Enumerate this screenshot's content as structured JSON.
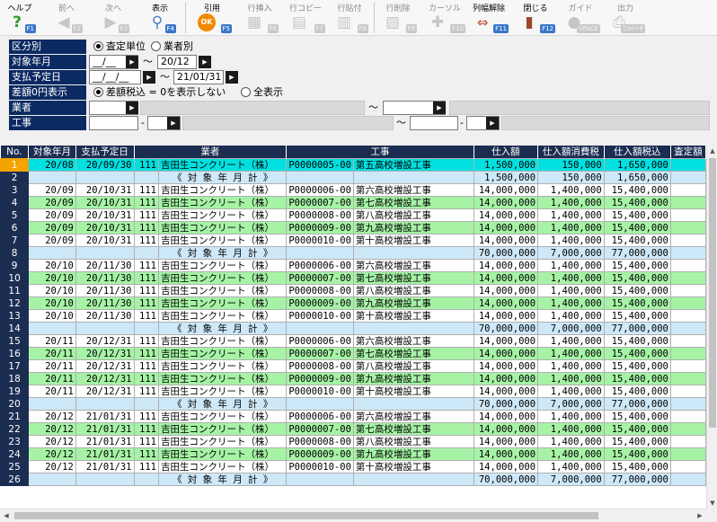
{
  "toolbar": {
    "help": {
      "label": "ヘルプ",
      "key": "F1"
    },
    "prev": {
      "label": "前へ",
      "key": "F2"
    },
    "next": {
      "label": "次へ",
      "key": "F3"
    },
    "show": {
      "label": "表示",
      "key": "F4"
    },
    "cite": {
      "label": "引用",
      "key": "F5",
      "icon_text": "OK"
    },
    "row_insert": {
      "label": "行挿入",
      "key": "F6"
    },
    "row_copy": {
      "label": "行コピー",
      "key": "F7"
    },
    "row_paste": {
      "label": "行貼付",
      "key": "F8"
    },
    "row_delete": {
      "label": "行削除",
      "key": "F9"
    },
    "cursor": {
      "label": "カーソル",
      "key": "F10"
    },
    "column_reset": {
      "label": "列幅解除",
      "key": "F11"
    },
    "close": {
      "label": "閉じる",
      "key": "F12"
    },
    "guide": {
      "label": "ガイド",
      "key": "SPACE"
    },
    "output": {
      "label": "出力",
      "key": "Ctrl+P"
    }
  },
  "filters": {
    "kubun": {
      "label": "区分別",
      "option1": "査定単位",
      "option2": "業者別",
      "selected": "査定単位"
    },
    "taisho": {
      "label": "対象年月",
      "from": "__/__",
      "tilde": "～",
      "to": "20/12"
    },
    "shiharai": {
      "label": "支払予定日",
      "from": "__/__/__",
      "tilde": "～",
      "to": "21/01/31"
    },
    "sagaku": {
      "label": "差額0円表示",
      "option1": "差額税込 = 0を表示しない",
      "option2": "全表示",
      "selected": "差額税込 = 0を表示しない"
    },
    "gyosha": {
      "label": "業者",
      "tilde": "～"
    },
    "koji": {
      "label": "工事",
      "dash": "-",
      "tilde": "～"
    }
  },
  "grid": {
    "columns": [
      "No.",
      "対象年月",
      "支払予定日",
      "業者",
      "工事",
      "仕入額",
      "仕入額消費税",
      "仕入額税込",
      "査定額"
    ],
    "rows": [
      {
        "no": "1",
        "ym": "20/08",
        "pay": "20/09/30",
        "vc": "111",
        "vn": "吉田生コンクリート（株）",
        "pc": "P0000005-00",
        "pn": "第五高校増設工事",
        "amt": "1,500,000",
        "tax": "150,000",
        "total": "1,650,000",
        "t": "sel"
      },
      {
        "no": "2",
        "sub": "《 対 象 年 月 計 》",
        "amt": "1,500,000",
        "tax": "150,000",
        "total": "1,650,000",
        "t": "s"
      },
      {
        "no": "3",
        "ym": "20/09",
        "pay": "20/10/31",
        "vc": "111",
        "vn": "吉田生コンクリート（株）",
        "pc": "P0000006-00",
        "pn": "第六高校増設工事",
        "amt": "14,000,000",
        "tax": "1,400,000",
        "total": "15,400,000",
        "t": "w"
      },
      {
        "no": "4",
        "ym": "20/09",
        "pay": "20/10/31",
        "vc": "111",
        "vn": "吉田生コンクリート（株）",
        "pc": "P0000007-00",
        "pn": "第七高校増設工事",
        "amt": "14,000,000",
        "tax": "1,400,000",
        "total": "15,400,000",
        "t": "g"
      },
      {
        "no": "5",
        "ym": "20/09",
        "pay": "20/10/31",
        "vc": "111",
        "vn": "吉田生コンクリート（株）",
        "pc": "P0000008-00",
        "pn": "第八高校増設工事",
        "amt": "14,000,000",
        "tax": "1,400,000",
        "total": "15,400,000",
        "t": "w"
      },
      {
        "no": "6",
        "ym": "20/09",
        "pay": "20/10/31",
        "vc": "111",
        "vn": "吉田生コンクリート（株）",
        "pc": "P0000009-00",
        "pn": "第九高校増設工事",
        "amt": "14,000,000",
        "tax": "1,400,000",
        "total": "15,400,000",
        "t": "g"
      },
      {
        "no": "7",
        "ym": "20/09",
        "pay": "20/10/31",
        "vc": "111",
        "vn": "吉田生コンクリート（株）",
        "pc": "P0000010-00",
        "pn": "第十高校増設工事",
        "amt": "14,000,000",
        "tax": "1,400,000",
        "total": "15,400,000",
        "t": "w"
      },
      {
        "no": "8",
        "sub": "《 対 象 年 月 計 》",
        "amt": "70,000,000",
        "tax": "7,000,000",
        "total": "77,000,000",
        "t": "s"
      },
      {
        "no": "9",
        "ym": "20/10",
        "pay": "20/11/30",
        "vc": "111",
        "vn": "吉田生コンクリート（株）",
        "pc": "P0000006-00",
        "pn": "第六高校増設工事",
        "amt": "14,000,000",
        "tax": "1,400,000",
        "total": "15,400,000",
        "t": "w"
      },
      {
        "no": "10",
        "ym": "20/10",
        "pay": "20/11/30",
        "vc": "111",
        "vn": "吉田生コンクリート（株）",
        "pc": "P0000007-00",
        "pn": "第七高校増設工事",
        "amt": "14,000,000",
        "tax": "1,400,000",
        "total": "15,400,000",
        "t": "g"
      },
      {
        "no": "11",
        "ym": "20/10",
        "pay": "20/11/30",
        "vc": "111",
        "vn": "吉田生コンクリート（株）",
        "pc": "P0000008-00",
        "pn": "第八高校増設工事",
        "amt": "14,000,000",
        "tax": "1,400,000",
        "total": "15,400,000",
        "t": "w"
      },
      {
        "no": "12",
        "ym": "20/10",
        "pay": "20/11/30",
        "vc": "111",
        "vn": "吉田生コンクリート（株）",
        "pc": "P0000009-00",
        "pn": "第九高校増設工事",
        "amt": "14,000,000",
        "tax": "1,400,000",
        "total": "15,400,000",
        "t": "g"
      },
      {
        "no": "13",
        "ym": "20/10",
        "pay": "20/11/30",
        "vc": "111",
        "vn": "吉田生コンクリート（株）",
        "pc": "P0000010-00",
        "pn": "第十高校増設工事",
        "amt": "14,000,000",
        "tax": "1,400,000",
        "total": "15,400,000",
        "t": "w"
      },
      {
        "no": "14",
        "sub": "《 対 象 年 月 計 》",
        "amt": "70,000,000",
        "tax": "7,000,000",
        "total": "77,000,000",
        "t": "s"
      },
      {
        "no": "15",
        "ym": "20/11",
        "pay": "20/12/31",
        "vc": "111",
        "vn": "吉田生コンクリート（株）",
        "pc": "P0000006-00",
        "pn": "第六高校増設工事",
        "amt": "14,000,000",
        "tax": "1,400,000",
        "total": "15,400,000",
        "t": "w"
      },
      {
        "no": "16",
        "ym": "20/11",
        "pay": "20/12/31",
        "vc": "111",
        "vn": "吉田生コンクリート（株）",
        "pc": "P0000007-00",
        "pn": "第七高校増設工事",
        "amt": "14,000,000",
        "tax": "1,400,000",
        "total": "15,400,000",
        "t": "g"
      },
      {
        "no": "17",
        "ym": "20/11",
        "pay": "20/12/31",
        "vc": "111",
        "vn": "吉田生コンクリート（株）",
        "pc": "P0000008-00",
        "pn": "第八高校増設工事",
        "amt": "14,000,000",
        "tax": "1,400,000",
        "total": "15,400,000",
        "t": "w"
      },
      {
        "no": "18",
        "ym": "20/11",
        "pay": "20/12/31",
        "vc": "111",
        "vn": "吉田生コンクリート（株）",
        "pc": "P0000009-00",
        "pn": "第九高校増設工事",
        "amt": "14,000,000",
        "tax": "1,400,000",
        "total": "15,400,000",
        "t": "g"
      },
      {
        "no": "19",
        "ym": "20/11",
        "pay": "20/12/31",
        "vc": "111",
        "vn": "吉田生コンクリート（株）",
        "pc": "P0000010-00",
        "pn": "第十高校増設工事",
        "amt": "14,000,000",
        "tax": "1,400,000",
        "total": "15,400,000",
        "t": "w"
      },
      {
        "no": "20",
        "sub": "《 対 象 年 月 計 》",
        "amt": "70,000,000",
        "tax": "7,000,000",
        "total": "77,000,000",
        "t": "s"
      },
      {
        "no": "21",
        "ym": "20/12",
        "pay": "21/01/31",
        "vc": "111",
        "vn": "吉田生コンクリート（株）",
        "pc": "P0000006-00",
        "pn": "第六高校増設工事",
        "amt": "14,000,000",
        "tax": "1,400,000",
        "total": "15,400,000",
        "t": "w"
      },
      {
        "no": "22",
        "ym": "20/12",
        "pay": "21/01/31",
        "vc": "111",
        "vn": "吉田生コンクリート（株）",
        "pc": "P0000007-00",
        "pn": "第七高校増設工事",
        "amt": "14,000,000",
        "tax": "1,400,000",
        "total": "15,400,000",
        "t": "g"
      },
      {
        "no": "23",
        "ym": "20/12",
        "pay": "21/01/31",
        "vc": "111",
        "vn": "吉田生コンクリート（株）",
        "pc": "P0000008-00",
        "pn": "第八高校増設工事",
        "amt": "14,000,000",
        "tax": "1,400,000",
        "total": "15,400,000",
        "t": "w"
      },
      {
        "no": "24",
        "ym": "20/12",
        "pay": "21/01/31",
        "vc": "111",
        "vn": "吉田生コンクリート（株）",
        "pc": "P0000009-00",
        "pn": "第九高校増設工事",
        "amt": "14,000,000",
        "tax": "1,400,000",
        "total": "15,400,000",
        "t": "g"
      },
      {
        "no": "25",
        "ym": "20/12",
        "pay": "21/01/31",
        "vc": "111",
        "vn": "吉田生コンクリート（株）",
        "pc": "P0000010-00",
        "pn": "第十高校増設工事",
        "amt": "14,000,000",
        "tax": "1,400,000",
        "total": "15,400,000",
        "t": "w"
      },
      {
        "no": "26",
        "sub": "《 対 象 年 月 計 》",
        "amt": "70,000,000",
        "tax": "7,000,000",
        "total": "77,000,000",
        "t": "s"
      }
    ]
  },
  "colors": {
    "header_navy": "#1c2d52",
    "label_navy": "#0c2a62",
    "row_green": "#a6f3a6",
    "row_subtotal": "#cde8f8",
    "row_selected": "#00e0e0",
    "selected_no": "#f5a300",
    "fkey_blue": "#3a76c9"
  }
}
